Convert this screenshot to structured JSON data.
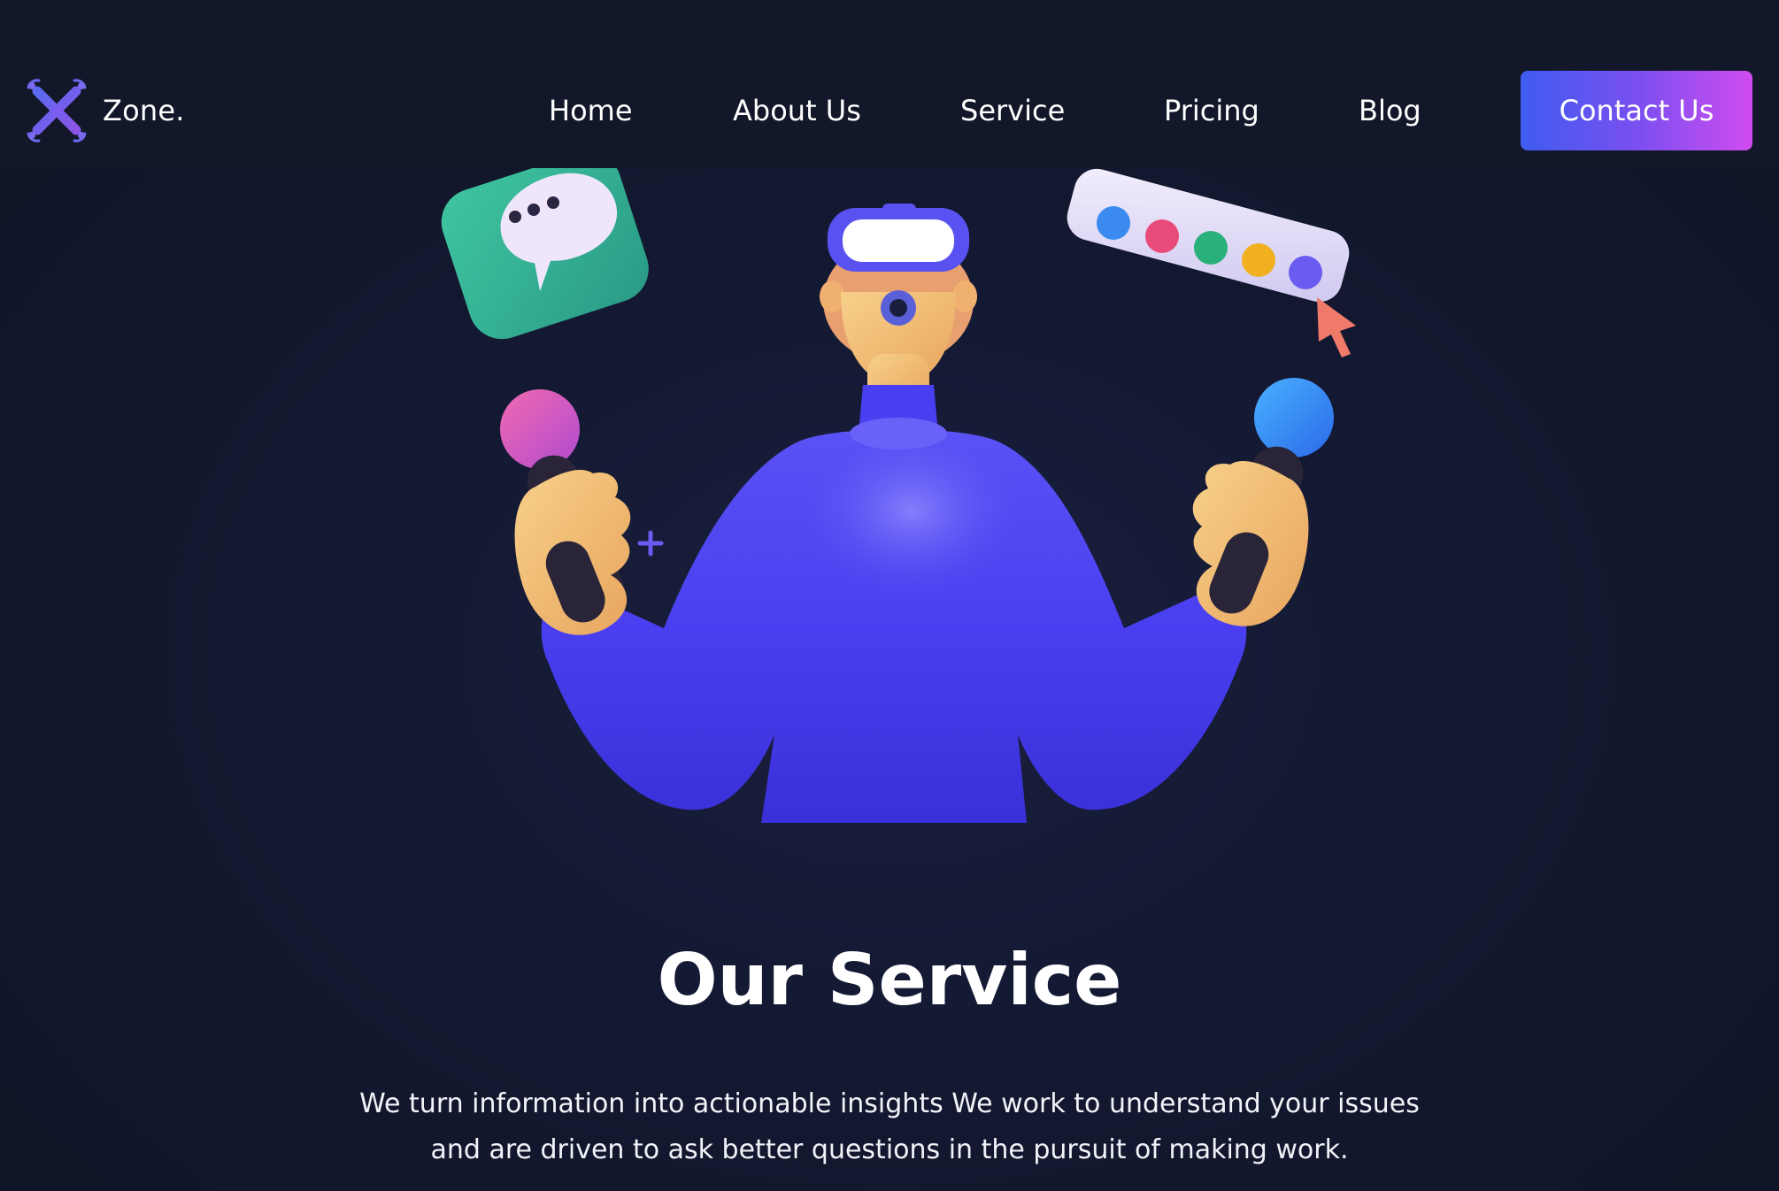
{
  "brand": {
    "name": "Zone.",
    "logo_icon": "drone-logo-icon"
  },
  "nav": {
    "items": [
      {
        "label": "Home"
      },
      {
        "label": "About Us"
      },
      {
        "label": "Service"
      },
      {
        "label": "Pricing"
      },
      {
        "label": "Blog"
      }
    ],
    "cta_label": "Contact Us"
  },
  "hero": {
    "illustration": "vr-person-with-controllers-illustration",
    "icons": [
      "chat-bubble-icon",
      "color-palette-icon",
      "cursor-arrow-icon",
      "plus-icon"
    ]
  },
  "section": {
    "title": "Our Service",
    "description": "We turn information into actionable insights We work to understand your issues and are driven to ask better questions in the pursuit of making work."
  },
  "colors": {
    "background": "#121829",
    "accent_start": "#3f5cf0",
    "accent_end": "#d04cf0",
    "brand_purple": "#6a5cf0",
    "sweater_blue": "#4a3ff0"
  }
}
